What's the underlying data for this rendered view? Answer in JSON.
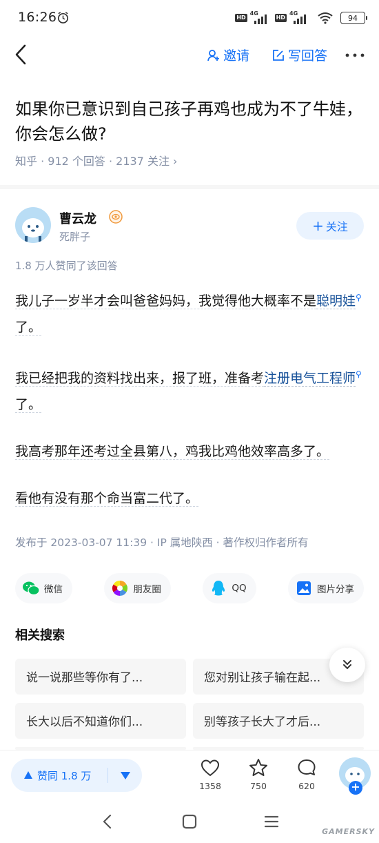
{
  "status_bar": {
    "time": "16:26",
    "hd": "HD",
    "network": "4G",
    "battery": "94"
  },
  "nav": {
    "invite_label": "邀请",
    "write_label": "写回答"
  },
  "question": {
    "title": "如果你已意识到自己孩子再鸡也成为不了牛娃，你会怎么做?",
    "meta": "知乎 · 912 个回答 · 2137 关注 ›"
  },
  "author": {
    "name": "曹云龙",
    "bio": "死胖子",
    "follow_label": "关注"
  },
  "answer": {
    "vote_summary": "1.8 万人赞同了该回答",
    "p1_a": "我儿子一岁半才会叫爸爸妈妈，我觉得他大概率不是",
    "p1_kw": "聪明娃",
    "p1_b": "了。",
    "p2_a": "我已经把我的资料找出来，报了班，准备考",
    "p2_kw": "注册电气工程师",
    "p2_b": "了。",
    "p3": "我高考那年还考过全县第八，鸡我比鸡他效率高多了。",
    "p4": "看他有没有那个命当富二代了。",
    "footer": "发布于 2023-03-07 11:39 · IP 属地陕西 · 著作权归作者所有"
  },
  "share": [
    {
      "label": "微信",
      "icon": "wechat-icon"
    },
    {
      "label": "朋友圈",
      "icon": "moments-icon"
    },
    {
      "label": "QQ",
      "icon": "qq-icon"
    },
    {
      "label": "图片分享",
      "icon": "image-share-icon"
    }
  ],
  "related": {
    "title": "相关搜索",
    "items": [
      "说一说那些等你有了...",
      "您对别让孩子输在起...",
      "长大以后不知道你们...",
      "别等孩子长大了才后..."
    ]
  },
  "bottom_bar": {
    "vote_label": "赞同 1.8 万",
    "likes": "1358",
    "favorites": "750",
    "comments": "620"
  },
  "watermark": "GAMERSKY",
  "colors": {
    "accent": "#1772f6",
    "meta": "#8590a6",
    "keyword": "#175199"
  }
}
